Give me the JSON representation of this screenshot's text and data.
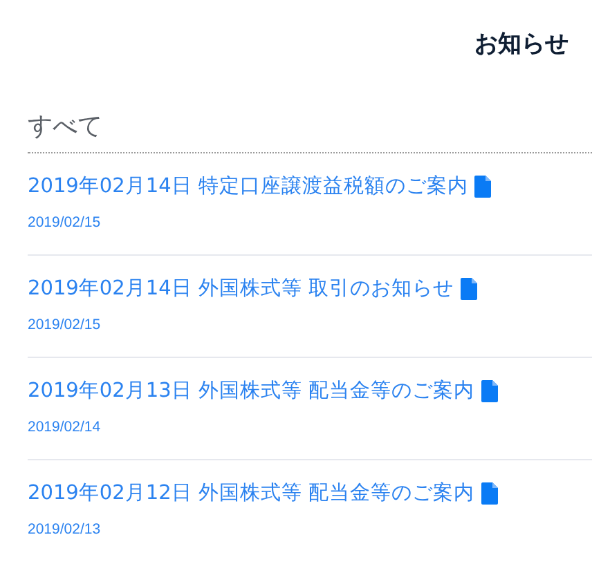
{
  "header": {
    "title": "お知らせ"
  },
  "section": {
    "heading": "すべて"
  },
  "notices": [
    {
      "title": "2019年02月14日 特定口座譲渡益税額のご案内",
      "date": "2019/02/15"
    },
    {
      "title": "2019年02月14日 外国株式等 取引のお知らせ",
      "date": "2019/02/15"
    },
    {
      "title": "2019年02月13日 外国株式等 配当金等のご案内",
      "date": "2019/02/14"
    },
    {
      "title": "2019年02月12日 外国株式等 配当金等のご案内",
      "date": "2019/02/13"
    }
  ]
}
